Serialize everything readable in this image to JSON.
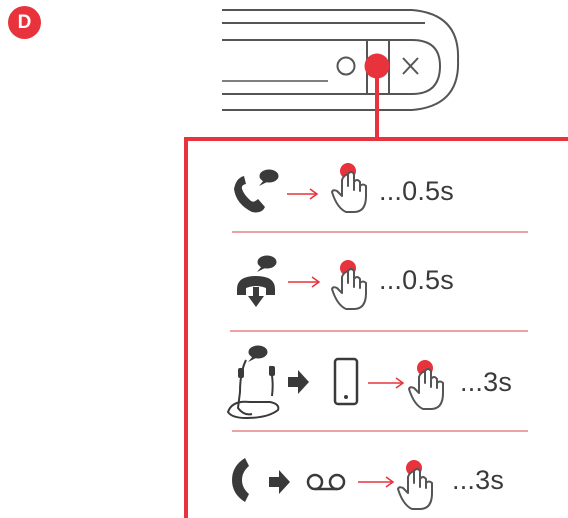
{
  "badge": {
    "letter": "D",
    "color": "#e8323c"
  },
  "colors": {
    "accent": "#e8323c",
    "ink": "#3a3a3a",
    "outline": "#555555",
    "divider": "#e06a6f"
  },
  "device": {
    "buttons": [
      "circle-button",
      "center-button",
      "x-button"
    ],
    "highlighted": "center-button"
  },
  "steps": [
    {
      "icons": [
        "incoming-call-icon",
        "speech-bubble-icon",
        "arrow-icon",
        "press-finger-icon"
      ],
      "duration": "...0.5s"
    },
    {
      "icons": [
        "hang-up-icon",
        "speech-bubble-icon",
        "arrow-icon",
        "press-finger-icon"
      ],
      "duration": "...0.5s"
    },
    {
      "icons": [
        "neckband-headset-icon",
        "speech-bubble-icon",
        "block-arrow-icon",
        "smartphone-icon",
        "arrow-icon",
        "press-finger-icon"
      ],
      "duration": "...3s"
    },
    {
      "icons": [
        "phone-handset-icon",
        "block-arrow-icon",
        "voicemail-icon",
        "arrow-icon",
        "press-finger-icon"
      ],
      "duration": "...3s"
    }
  ]
}
